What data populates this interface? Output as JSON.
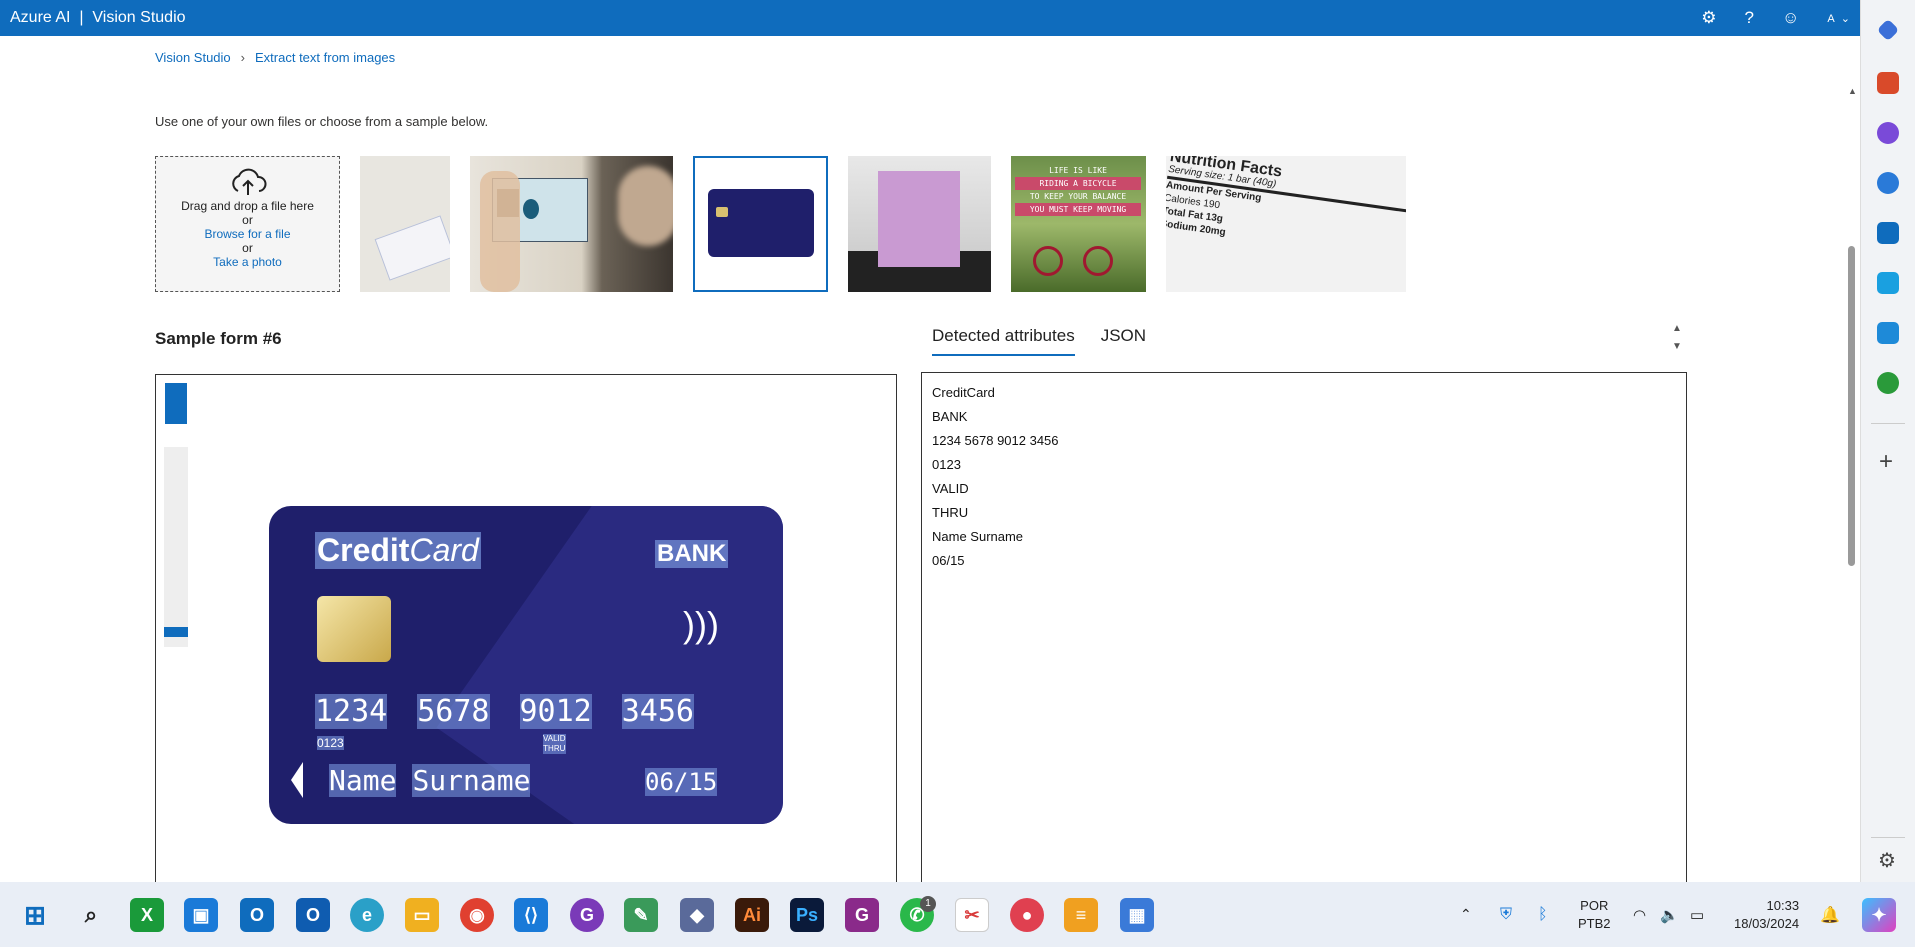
{
  "app": {
    "title": "Azure AI  |  Vision Studio"
  },
  "breadcrumb": {
    "items": [
      "Vision Studio",
      "Extract text from images"
    ]
  },
  "intro": "Use one of your own files or choose from a sample below.",
  "upload": {
    "drag_text": "Drag and drop a file here",
    "or1": "or",
    "browse": "Browse for a file",
    "or2": "or",
    "take_photo": "Take a photo"
  },
  "section": {
    "title": "Sample form #6"
  },
  "tabs": [
    {
      "label": "Detected attributes",
      "active": true
    },
    {
      "label": "JSON",
      "active": false
    }
  ],
  "attributes": [
    "CreditCard",
    "BANK",
    "1234 5678 9012 3456",
    "0123",
    "VALID",
    "THRU",
    "Name Surname",
    "06/15"
  ],
  "card": {
    "brand_bold": "Credit",
    "brand_italic": "Card",
    "bank": "BANK",
    "number_groups": [
      "1234",
      "5678",
      "9012",
      "3456"
    ],
    "small_number": "0123",
    "valid": "VALID",
    "thru": "THRU",
    "name": "Name",
    "surname": "Surname",
    "expiry": "06/15",
    "color": "#1f1f6b"
  },
  "thumbnails": [
    {
      "name": "social-security-card"
    },
    {
      "name": "id-card-man"
    },
    {
      "name": "credit-card",
      "selected": true
    },
    {
      "name": "sticky-note"
    },
    {
      "name": "bicycle-poster"
    },
    {
      "name": "nutrition-facts"
    }
  ],
  "nutrition": {
    "title": "Nutrition Facts",
    "serving_size": "Serving size: 1 bar (40g)",
    "amount": "Amount Per Serving",
    "calories": "Calories 190",
    "total_fat": "Total Fat 13g",
    "sodium": "Sodium 20mg"
  },
  "poster": {
    "line1": "LIFE IS LIKE",
    "line2": "RIDING A BICYCLE",
    "line3": "TO KEEP YOUR BALANCE",
    "line4": "YOU MUST KEEP MOVING"
  },
  "taskbar": {
    "language": "POR",
    "layout": "PTB2",
    "time": "10:33",
    "date": "18/03/2024",
    "whatsapp_badge": "1"
  },
  "colors": {
    "accent": "#0f6cbd",
    "topbar": "#0f6cbd"
  }
}
